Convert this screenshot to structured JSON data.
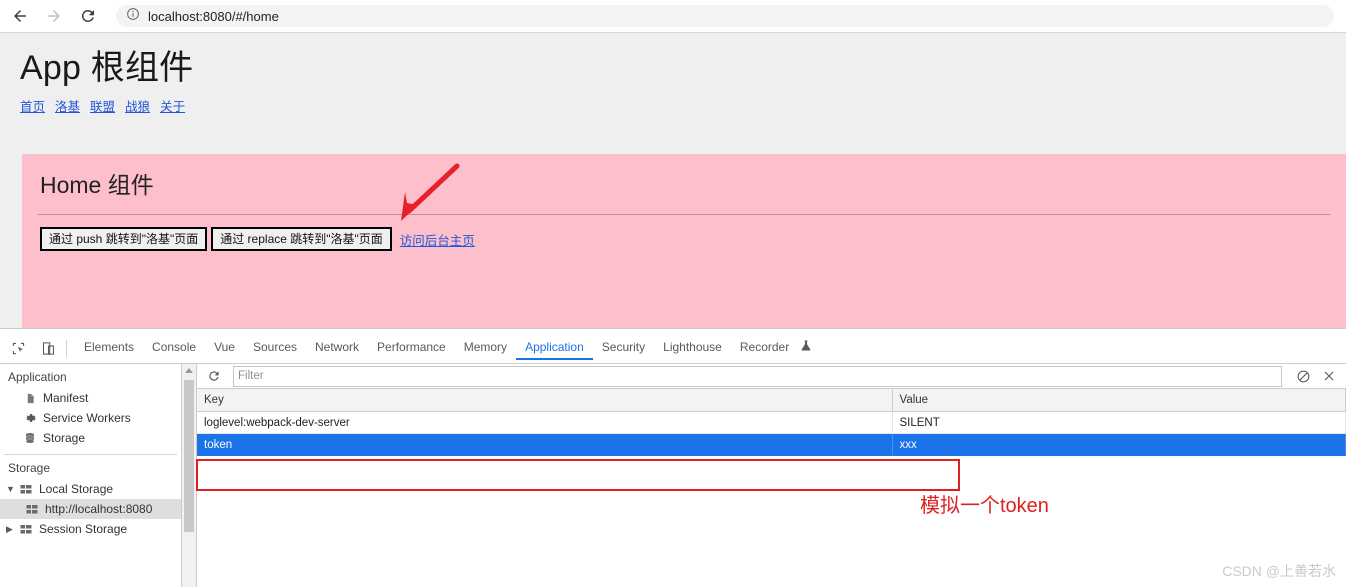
{
  "browser": {
    "back_icon": "arrow-left-icon",
    "forward_icon": "arrow-right-icon",
    "reload_icon": "reload-icon",
    "info_icon": "info-circle-icon",
    "url": "localhost:8080/#/home"
  },
  "page": {
    "app_title": "App 根组件",
    "nav": [
      {
        "label": "首页"
      },
      {
        "label": "洛基"
      },
      {
        "label": "联盟"
      },
      {
        "label": "战狼"
      },
      {
        "label": "关于"
      }
    ],
    "panel": {
      "title": "Home 组件",
      "buttons": [
        {
          "label": "通过 push 跳转到\"洛基\"页面"
        },
        {
          "label": "通过 replace 跳转到\"洛基\"页面"
        }
      ],
      "link": "访问后台主页"
    }
  },
  "devtools": {
    "inspect_icon": "inspect-element-icon",
    "device_icon": "device-toolbar-icon",
    "tabs": [
      {
        "label": "Elements",
        "active": false
      },
      {
        "label": "Console",
        "active": false
      },
      {
        "label": "Vue",
        "active": false
      },
      {
        "label": "Sources",
        "active": false
      },
      {
        "label": "Network",
        "active": false
      },
      {
        "label": "Performance",
        "active": false
      },
      {
        "label": "Memory",
        "active": false
      },
      {
        "label": "Application",
        "active": true
      },
      {
        "label": "Security",
        "active": false
      },
      {
        "label": "Lighthouse",
        "active": false
      },
      {
        "label": "Recorder",
        "active": false
      }
    ],
    "recorder_badge_icon": "beaker-icon",
    "sidebar": {
      "application_section": "Application",
      "application_items": [
        {
          "label": "Manifest",
          "icon": "document-icon"
        },
        {
          "label": "Service Workers",
          "icon": "gear-icon"
        },
        {
          "label": "Storage",
          "icon": "database-icon"
        }
      ],
      "storage_section": "Storage",
      "storage_items": [
        {
          "label": "Local Storage",
          "icon": "storage-grid-icon",
          "expanded": true,
          "selected": false
        },
        {
          "label": "http://localhost:8080",
          "icon": "storage-grid-icon",
          "child": true,
          "selected": true
        },
        {
          "label": "Session Storage",
          "icon": "storage-grid-icon",
          "expanded": false,
          "selected": false
        }
      ]
    },
    "toolbar": {
      "refresh_icon": "refresh-icon",
      "filter_placeholder": "Filter",
      "clear_icon": "clear-circle-slash-icon",
      "close_icon": "close-x-icon"
    },
    "table": {
      "columns": [
        "Key",
        "Value"
      ],
      "rows": [
        {
          "key": "loglevel:webpack-dev-server",
          "value": "SILENT",
          "selected": false
        },
        {
          "key": "token",
          "value": "xxx",
          "selected": true
        }
      ]
    }
  },
  "annotations": {
    "note_text": "模拟一个token",
    "accent_color": "#e02020"
  },
  "watermark": "CSDN @上善若水"
}
